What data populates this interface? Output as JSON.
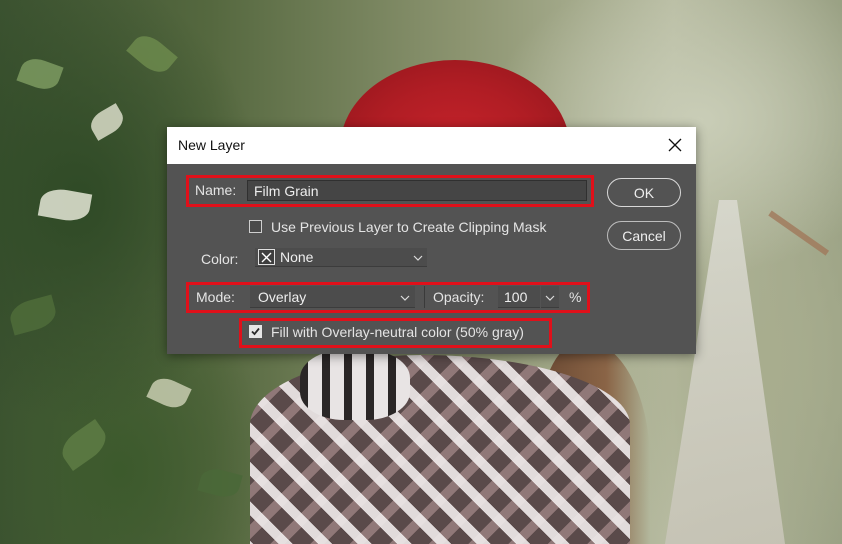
{
  "dialog": {
    "title": "New Layer",
    "name_label": "Name:",
    "name_value": "Film Grain",
    "clipping_mask_label": "Use Previous Layer to Create Clipping Mask",
    "clipping_mask_checked": false,
    "color_label": "Color:",
    "color_value": "None",
    "mode_label": "Mode:",
    "mode_value": "Overlay",
    "opacity_label": "Opacity:",
    "opacity_value": "100",
    "opacity_unit": "%",
    "fill_neutral_label": "Fill with Overlay-neutral color (50% gray)",
    "fill_neutral_checked": true,
    "ok_label": "OK",
    "cancel_label": "Cancel"
  },
  "icons": {
    "close": "close-icon",
    "dropdown": "chevron-down-icon",
    "color_swatch": "no-color-x-icon",
    "checkmark": "checkmark-icon"
  },
  "colors": {
    "dialog_bg": "#535353",
    "titlebar_bg": "#ffffff",
    "highlight": "#e0101a",
    "hat_red": "#c6232b"
  }
}
